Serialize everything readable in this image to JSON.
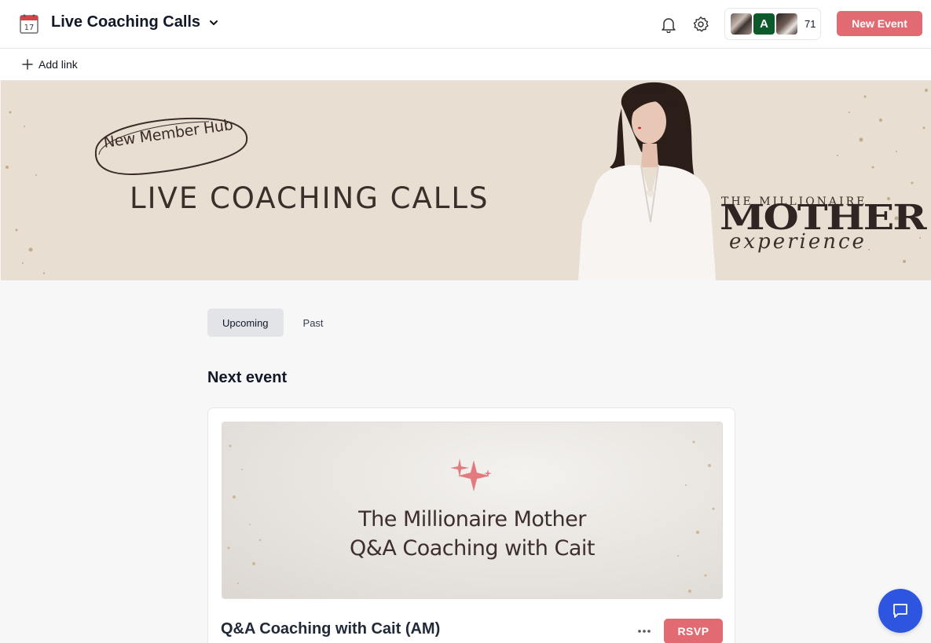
{
  "header": {
    "title": "Live Coaching Calls",
    "members_initial": "A",
    "members_count": "71",
    "new_event_label": "New Event",
    "icons": [
      "calendar-icon",
      "chevron-down-icon",
      "bell-icon",
      "gear-icon"
    ]
  },
  "links": {
    "add_link_label": "Add link"
  },
  "banner": {
    "badge": "New Member Hub",
    "headline": "LIVE COACHING CALLS",
    "brand_line1": "THE MILLIONAIRE",
    "brand_line2": "MOTHER",
    "brand_line3": "experience"
  },
  "tabs": [
    {
      "label": "Upcoming",
      "active": true
    },
    {
      "label": "Past",
      "active": false
    }
  ],
  "main": {
    "section_title": "Next event"
  },
  "event": {
    "cover_line1": "The Millionaire Mother",
    "cover_line2": "Q&A Coaching with Cait",
    "name": "Q&A Coaching with Cait (AM)",
    "rsvp_label": "RSVP"
  },
  "colors": {
    "accent": "#e26b73",
    "chat": "#2d55e0",
    "banner_bg": "#e8dfd2"
  }
}
